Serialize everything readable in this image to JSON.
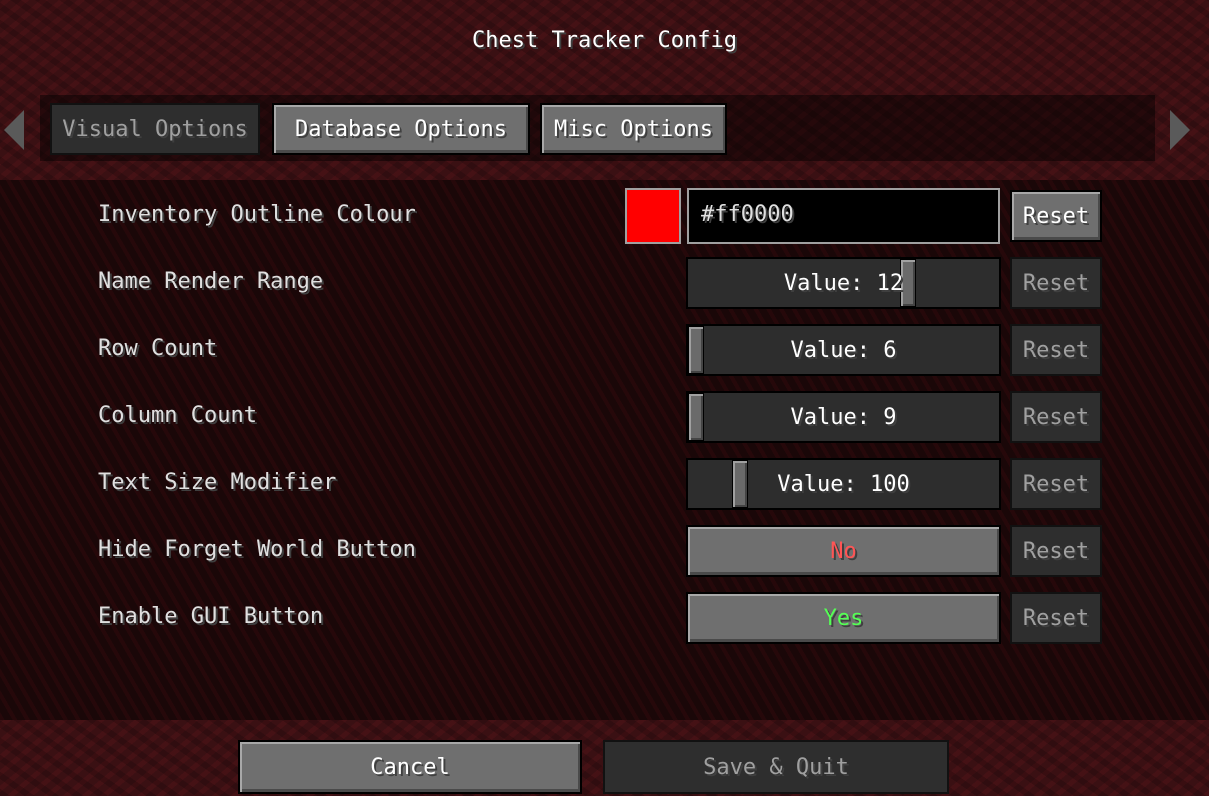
{
  "title": "Chest Tracker Config",
  "tabs": [
    {
      "label": "Visual Options",
      "selected": true
    },
    {
      "label": "Database Options",
      "selected": false
    },
    {
      "label": "Misc Options",
      "selected": false
    }
  ],
  "options": [
    {
      "label": "Inventory Outline Colour",
      "value": "#ff0000",
      "swatch_color": "#ff0000",
      "reset": "Reset",
      "reset_enabled": true
    },
    {
      "label": "Name Render Range",
      "value": "Value: 12",
      "slider_fraction": 0.72,
      "reset": "Reset"
    },
    {
      "label": "Row Count",
      "value": "Value: 6",
      "slider_fraction": 0.0,
      "reset": "Reset"
    },
    {
      "label": "Column Count",
      "value": "Value: 9",
      "slider_fraction": 0.0,
      "reset": "Reset"
    },
    {
      "label": "Text Size Modifier",
      "value": "Value: 100",
      "slider_fraction": 0.15,
      "reset": "Reset"
    },
    {
      "label": "Hide Forget World Button",
      "value": "No",
      "value_color": "#ff5555",
      "reset": "Reset"
    },
    {
      "label": "Enable GUI Button",
      "value": "Yes",
      "value_color": "#55ff55",
      "reset": "Reset"
    }
  ],
  "footer": {
    "cancel": "Cancel",
    "save": "Save & Quit"
  }
}
